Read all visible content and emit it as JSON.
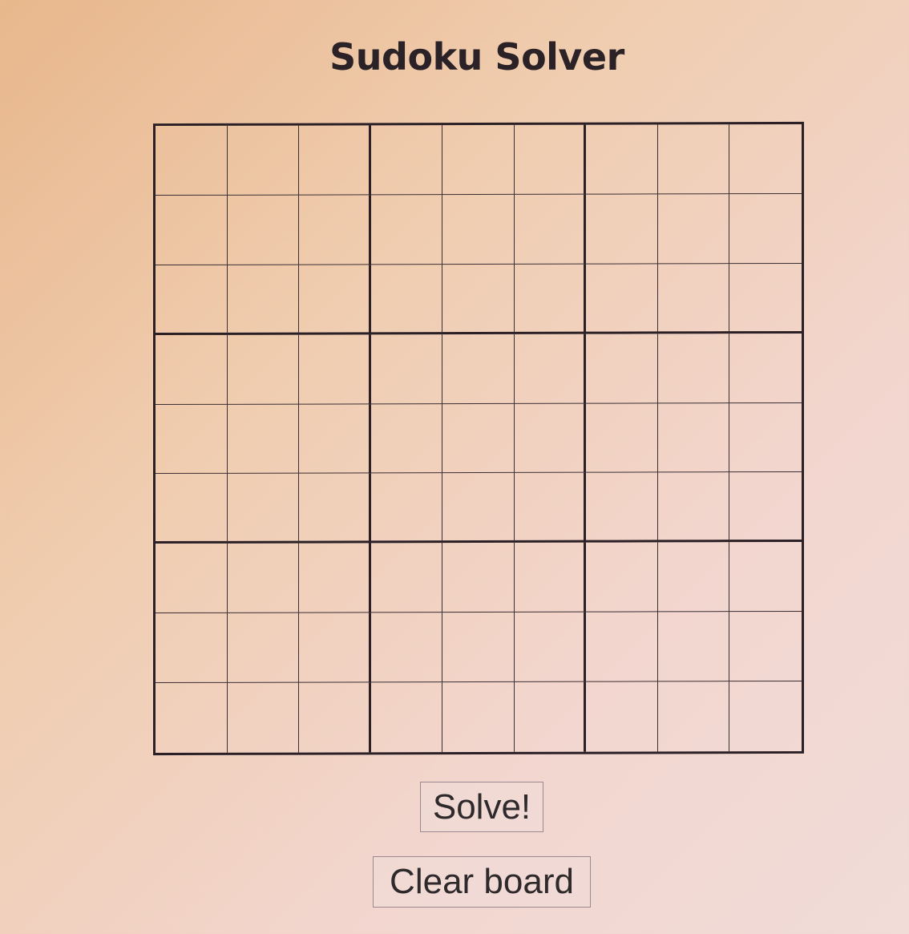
{
  "page": {
    "title": "Sudoku Solver"
  },
  "board": {
    "rows": [
      [
        "",
        "",
        "",
        "",
        "",
        "",
        "",
        "",
        ""
      ],
      [
        "",
        "",
        "",
        "",
        "",
        "",
        "",
        "",
        ""
      ],
      [
        "",
        "",
        "",
        "",
        "",
        "",
        "",
        "",
        ""
      ],
      [
        "",
        "",
        "",
        "",
        "",
        "",
        "",
        "",
        ""
      ],
      [
        "",
        "",
        "",
        "",
        "",
        "",
        "",
        "",
        ""
      ],
      [
        "",
        "",
        "",
        "",
        "",
        "",
        "",
        "",
        ""
      ],
      [
        "",
        "",
        "",
        "",
        "",
        "",
        "",
        "",
        ""
      ],
      [
        "",
        "",
        "",
        "",
        "",
        "",
        "",
        "",
        ""
      ],
      [
        "",
        "",
        "",
        "",
        "",
        "",
        "",
        "",
        ""
      ]
    ]
  },
  "actions": {
    "solve_label": "Solve!",
    "clear_label": "Clear board"
  }
}
